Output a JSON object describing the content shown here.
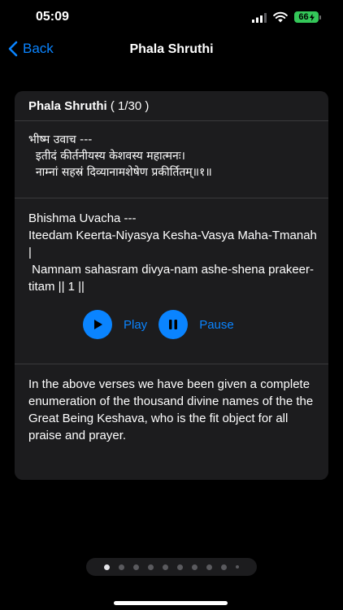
{
  "status_bar": {
    "time": "05:09",
    "battery": "66"
  },
  "nav": {
    "back_label": "Back",
    "title": "Phala Shruthi"
  },
  "card": {
    "title": "Phala Shruthi",
    "counter": "( 1/30 )",
    "sanskrit": "भीष्म उवाच ---\n  इतीदं कीर्तनीयस्य केशवस्य महात्मनः।\n  नाम्नां सहस्रं दिव्यानामशेषेण प्रकीर्तितम्॥१॥",
    "transliteration": "Bhishma Uvacha ---\nIteedam Keerta-Niyasya Kesha-Vasya Maha-Tmanah |\n Namnam sahasram divya-nam ashe-shena prakeer-titam || 1 ||",
    "play_label": "Play",
    "pause_label": "Pause",
    "description": "In the above verses we have been given a complete enumeration of the thousand divine names of the the Great Being Keshava, who is the fit object for all praise and prayer."
  },
  "pager": {
    "total_dots": 10,
    "active_index": 0
  },
  "colors": {
    "accent": "#0a84ff",
    "card_bg": "#1c1c1e",
    "battery": "#34c759"
  }
}
